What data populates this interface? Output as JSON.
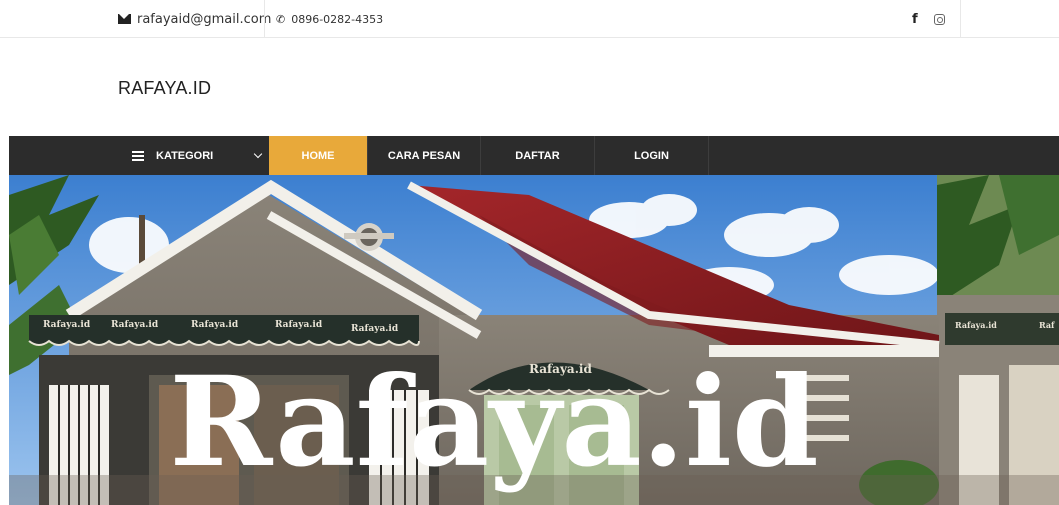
{
  "topbar": {
    "email": "rafayaid@gmail.com",
    "phone": "0896-0282-4353",
    "facebook_label": "f",
    "icons": {
      "email": "envelope-icon",
      "phone": "phone-icon",
      "facebook": "facebook-icon",
      "instagram": "instagram-icon"
    }
  },
  "logo": {
    "text": "RAFAYA.ID"
  },
  "nav": {
    "category_label": "KATEGORI",
    "items": [
      {
        "label": "HOME",
        "active": true
      },
      {
        "label": "CARA PESAN",
        "active": false
      },
      {
        "label": "DAFTAR",
        "active": false
      },
      {
        "label": "LOGIN",
        "active": false
      }
    ]
  },
  "hero": {
    "headline": "Rafaya.id",
    "sign_text": "Rafaya.id",
    "awning_labels": [
      "Rafaya.id",
      "Rafaya.id",
      "Rafaya.id",
      "Rafaya.id",
      "Rafaya.id"
    ],
    "side_labels": [
      "Rafaya.id",
      "Raf"
    ]
  },
  "colors": {
    "nav_bg": "#2c2c2c",
    "nav_active": "#e8a93a",
    "roof": "#8e1e22",
    "sky": "#4f8fd6"
  }
}
